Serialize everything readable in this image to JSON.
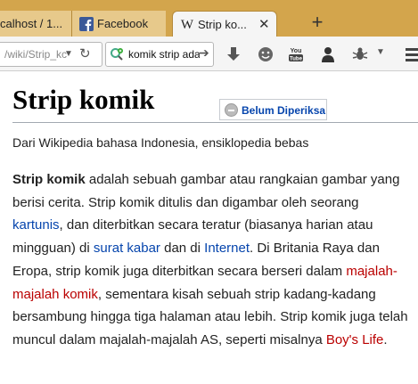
{
  "tabs": [
    {
      "label": "calhost / 1...",
      "active": false
    },
    {
      "label": "Facebook",
      "active": false
    },
    {
      "label": "Strip ko...",
      "active": true
    }
  ],
  "navbar": {
    "url": "/wiki/Strip_kc",
    "search_query": "komik strip ada"
  },
  "article": {
    "title": "Strip komik",
    "badge": "Belum Diperiksa",
    "tagline": "Dari Wikipedia bahasa Indonesia, ensiklopedia bebas",
    "p_bold": "Strip komik",
    "p_t1": " adalah sebuah gambar atau rangkaian gambar yang berisi cerita. Strip komik ditulis dan digambar oleh seorang ",
    "link_kartunis": "kartunis",
    "p_t2": ", dan diterbitkan secara teratur (biasanya harian atau mingguan) di ",
    "link_surat_kabar": "surat kabar",
    "p_t3": " dan di ",
    "link_internet": "Internet",
    "p_t4": ". Di Britania Raya dan Eropa, strip komik juga diterbitkan secara berseri dalam ",
    "link_majalah": "majalah-majalah komik",
    "p_t5": ", sementara kisah sebuah strip kadang-kadang bersambung hingga tiga halaman atau lebih. Strip komik juga telah muncul dalam majalah-majalah AS, seperti misalnya ",
    "link_boys_life": "Boy's Life",
    "p_t6": "."
  },
  "colors": {
    "tabstrip": "#d3a54c",
    "link_blue": "#0645ad",
    "link_red": "#ba0000"
  }
}
